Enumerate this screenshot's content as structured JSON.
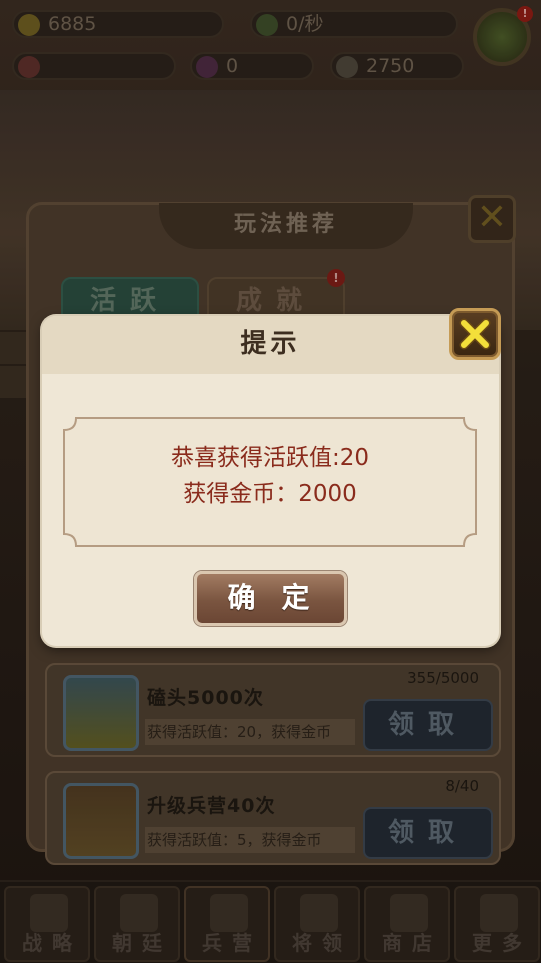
{
  "hud": {
    "gold": "6885",
    "rate": "0/秒",
    "gems": "0",
    "food": "2750"
  },
  "panel": {
    "title": "玩法推荐",
    "tabs": [
      {
        "label": "活跃",
        "active": true
      },
      {
        "label": "成就",
        "active": false,
        "badge": "!"
      }
    ],
    "tasks": [
      {
        "name": "磕头5000次",
        "desc": "获得活跃值：20，获得金币",
        "progress": "355/5000",
        "button": "领取"
      },
      {
        "name": "升级兵营40次",
        "desc": "获得活跃值：5，获得金币",
        "progress": "8/40",
        "button": "领取"
      }
    ],
    "close_icon": "close-x-icon"
  },
  "bottom_nav": [
    {
      "label": "战略",
      "icon": "castle-icon"
    },
    {
      "label": "朝廷",
      "icon": "palace-icon"
    },
    {
      "label": "兵营",
      "icon": "swords-icon"
    },
    {
      "label": "将领",
      "icon": "general-icon"
    },
    {
      "label": "商店",
      "icon": "shop-icon"
    },
    {
      "label": "更多",
      "icon": "grid-icon"
    }
  ],
  "dialog": {
    "title": "提示",
    "line1": "恭喜获得活跃值:20",
    "line2": "获得金币：2000",
    "confirm_label": "确定",
    "close_icon": "close-x-icon"
  },
  "colors": {
    "dialog_bg": "#efe7d6",
    "message_text": "#8a2b1c",
    "confirm_btn": "#7a5540"
  }
}
